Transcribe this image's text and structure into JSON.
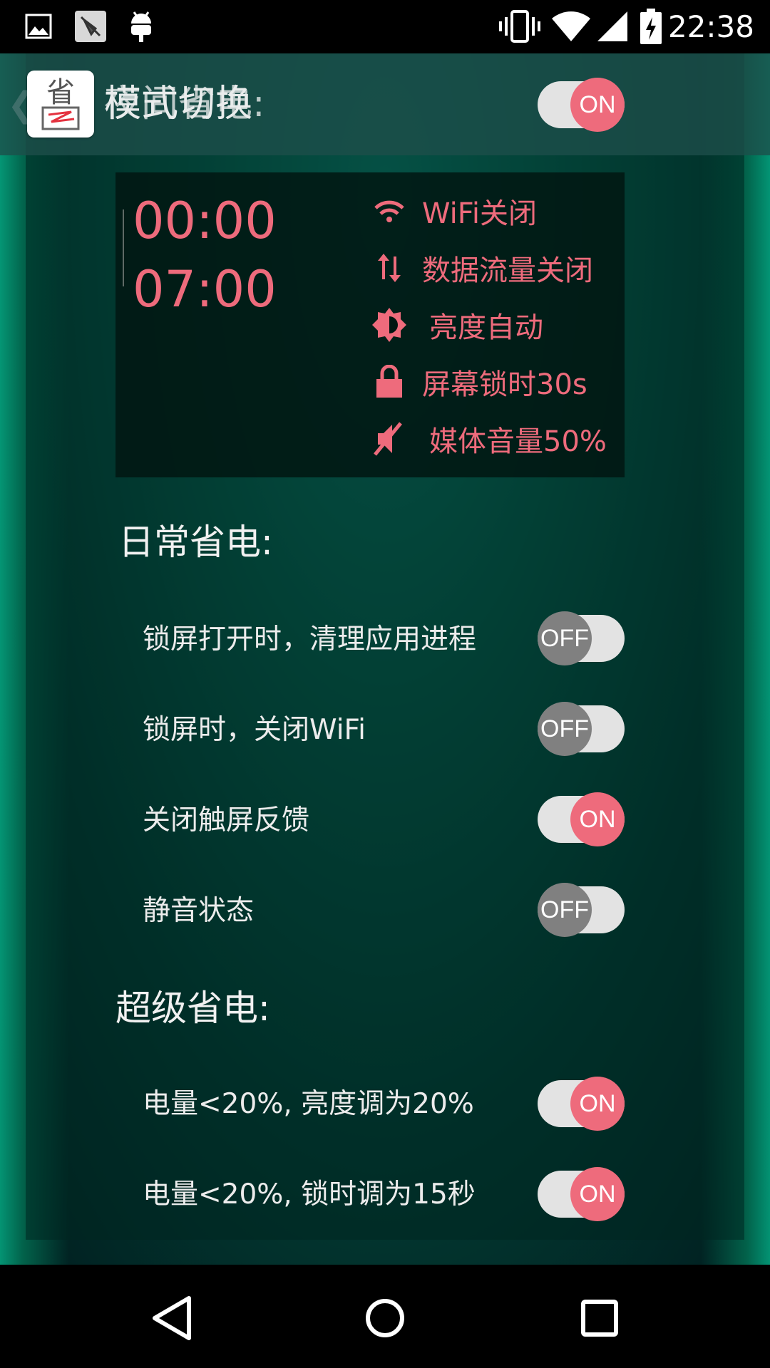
{
  "status_bar": {
    "time": "22:38",
    "left_icons": [
      "image-icon",
      "muted-app-icon",
      "android-icon"
    ],
    "right_icons": [
      "vibrate-icon",
      "wifi-icon",
      "signal-icon",
      "battery-charging-icon"
    ]
  },
  "header": {
    "title_primary": "模式切换",
    "title_overlay": "夜间省电:",
    "toggle_state": "ON"
  },
  "schedule": {
    "start_time": "00:00",
    "end_time": "07:00",
    "actions": [
      {
        "icon": "wifi-icon",
        "label": "WiFi关闭"
      },
      {
        "icon": "data-transfer-icon",
        "label": "数据流量关闭"
      },
      {
        "icon": "brightness-auto-icon",
        "label": "亮度自动"
      },
      {
        "icon": "lock-icon",
        "label": "屏幕锁时30s"
      },
      {
        "icon": "volume-mute-icon",
        "label": "媒体音量50%"
      }
    ]
  },
  "daily": {
    "title": "日常省电:",
    "items": [
      {
        "label": "锁屏打开时，清理应用进程",
        "state": "OFF"
      },
      {
        "label": "锁屏时，关闭WiFi",
        "state": "OFF"
      },
      {
        "label": "关闭触屏反馈",
        "state": "ON"
      },
      {
        "label": "静音状态",
        "state": "OFF"
      }
    ]
  },
  "super": {
    "title": "超级省电:",
    "items": [
      {
        "label": "电量<20%, 亮度调为20%",
        "state": "ON"
      },
      {
        "label": "电量<20%, 锁时调为15秒",
        "state": "ON"
      }
    ]
  },
  "nav": {
    "buttons": [
      "back-icon",
      "home-icon",
      "recents-icon"
    ]
  },
  "colors": {
    "accent": "#ee6b7c",
    "toggle_off": "#808080",
    "track": "#e3e3e3",
    "teal": "#06604f"
  }
}
